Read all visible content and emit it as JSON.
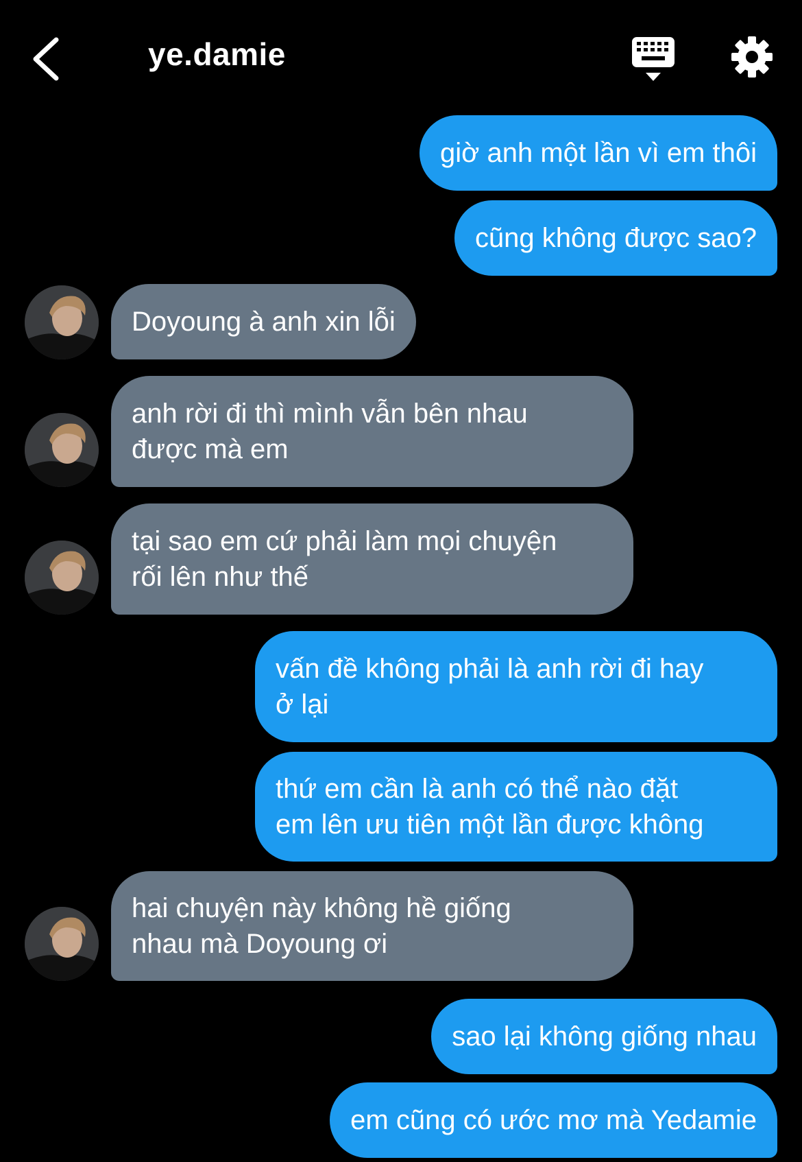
{
  "header": {
    "back_icon": "chevron-left-icon",
    "title": "ye.damie",
    "keyboard_icon": "keyboard-icon",
    "settings_icon": "gear-icon"
  },
  "colors": {
    "background": "#000000",
    "sent_bubble": "#1d9bf0",
    "received_bubble": "#677685",
    "text": "#ffffff"
  },
  "messages": [
    {
      "direction": "sent",
      "text": "giờ anh một lần vì em thôi"
    },
    {
      "direction": "sent",
      "text": "cũng không được sao?"
    },
    {
      "direction": "received",
      "text": "Doyoung à anh xin lỗi"
    },
    {
      "direction": "received",
      "text": "anh rời đi thì mình vẫn bên nhau\nđược mà em"
    },
    {
      "direction": "received",
      "text": "tại sao em cứ phải làm mọi chuyện\nrối lên như thế"
    },
    {
      "direction": "sent",
      "text": "vấn đề không phải là anh rời đi hay\nở lại"
    },
    {
      "direction": "sent",
      "text": "thứ em cần là anh có thể nào đặt\nem lên ưu tiên một lần được không"
    },
    {
      "direction": "received",
      "text": "hai chuyện này không hề giống\nnhau mà Doyoung ơi"
    },
    {
      "direction": "sent",
      "text": "sao lại không giống nhau"
    },
    {
      "direction": "sent",
      "text": "em cũng có ước mơ mà Yedamie"
    }
  ]
}
